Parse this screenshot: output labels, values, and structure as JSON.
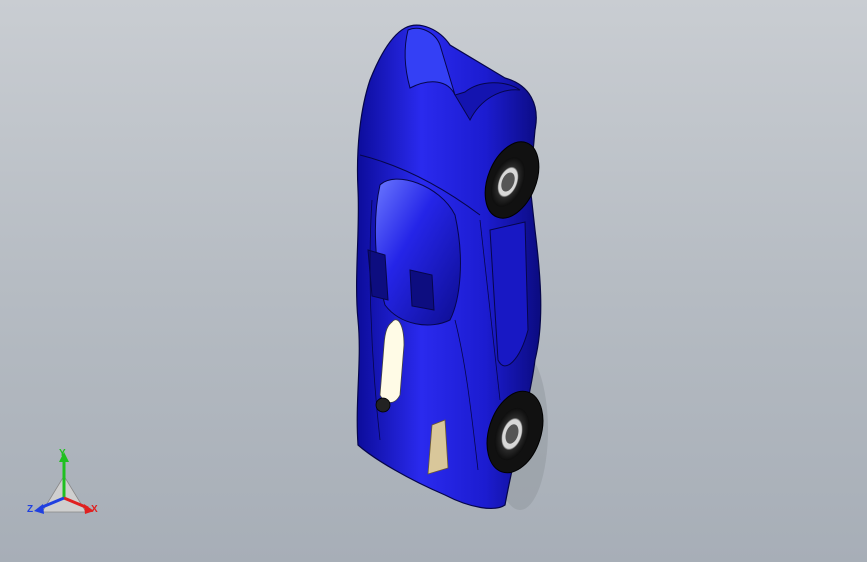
{
  "viewport": {
    "background_top": "#c9cdd2",
    "background_bottom": "#a7aeb7"
  },
  "model": {
    "body_color": "#1f1fd6",
    "body_highlight": "#4a55ff",
    "body_shadow": "#0c0c8a",
    "tire_color": "#1a1a1a",
    "accent_color": "#d9c79a",
    "light_color": "#fffbe6"
  },
  "triad": {
    "x_label": "X",
    "y_label": "Y",
    "z_label": "Z",
    "x_color": "#e02020",
    "y_color": "#20c020",
    "z_color": "#2040e0"
  }
}
